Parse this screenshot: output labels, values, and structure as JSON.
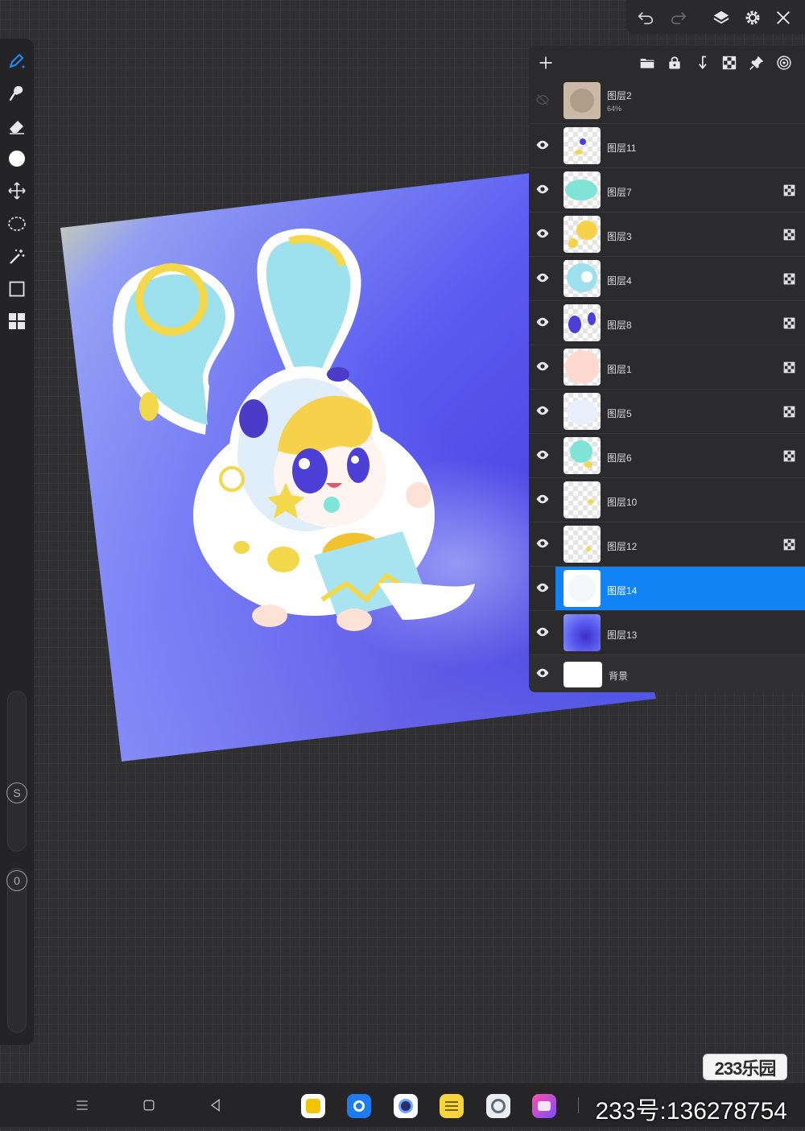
{
  "left_toolbar": {
    "tools": [
      {
        "icon": "brush-icon",
        "active": true
      },
      {
        "icon": "smudge-icon"
      },
      {
        "icon": "eraser-icon"
      },
      {
        "icon": "color-swatch-icon"
      },
      {
        "icon": "move-transform-icon"
      },
      {
        "icon": "lasso-selection-icon"
      },
      {
        "icon": "magic-wand-icon"
      },
      {
        "icon": "rectangle-shape-icon"
      },
      {
        "icon": "grid-layout-icon"
      }
    ],
    "size_slider_label": "S",
    "opacity_slider_label": "0"
  },
  "top_toolbar": {
    "icons": [
      "undo-icon",
      "redo-icon",
      "layers-icon",
      "settings-icon",
      "close-icon"
    ]
  },
  "layer_panel": {
    "toolbar_icons": [
      "add-layer-icon",
      "folder-icon",
      "lock-icon",
      "merge-down-icon",
      "alpha-lock-icon",
      "pin-icon",
      "blend-mode-icon"
    ],
    "layers": [
      {
        "name": "图层2",
        "opacity": "64%",
        "visible": false,
        "alpha_lock": false,
        "selected": false
      },
      {
        "name": "图层11",
        "visible": true,
        "alpha_lock": false,
        "selected": false
      },
      {
        "name": "图层7",
        "visible": true,
        "alpha_lock": true,
        "selected": false
      },
      {
        "name": "图层3",
        "visible": true,
        "alpha_lock": true,
        "selected": false
      },
      {
        "name": "图层4",
        "visible": true,
        "alpha_lock": true,
        "selected": false
      },
      {
        "name": "图层8",
        "visible": true,
        "alpha_lock": true,
        "selected": false
      },
      {
        "name": "图层1",
        "visible": true,
        "alpha_lock": true,
        "selected": false
      },
      {
        "name": "图层5",
        "visible": true,
        "alpha_lock": true,
        "selected": false
      },
      {
        "name": "图层6",
        "visible": true,
        "alpha_lock": true,
        "selected": false
      },
      {
        "name": "图层10",
        "visible": true,
        "alpha_lock": false,
        "selected": false
      },
      {
        "name": "图层12",
        "visible": true,
        "alpha_lock": true,
        "selected": false
      },
      {
        "name": "图层14",
        "visible": true,
        "alpha_lock": false,
        "selected": true
      },
      {
        "name": "图层13",
        "visible": true,
        "alpha_lock": false,
        "selected": false
      },
      {
        "name": "背景",
        "visible": true,
        "alpha_lock": false,
        "selected": false
      }
    ]
  },
  "nav_bar": {
    "buttons": [
      "menu-icon",
      "home-icon",
      "back-icon"
    ],
    "dock_apps": [
      "notes-app-icon",
      "browser-app-icon",
      "camera-app-icon",
      "memo-app-icon",
      "settings-app-icon",
      "gallery-app-icon"
    ]
  },
  "badge": "233乐园",
  "watermark": "233号:136278754",
  "colors": {
    "accent": "#1183f5",
    "panel": "#2b2b2d",
    "canvas_bg": "#2f2f31"
  }
}
